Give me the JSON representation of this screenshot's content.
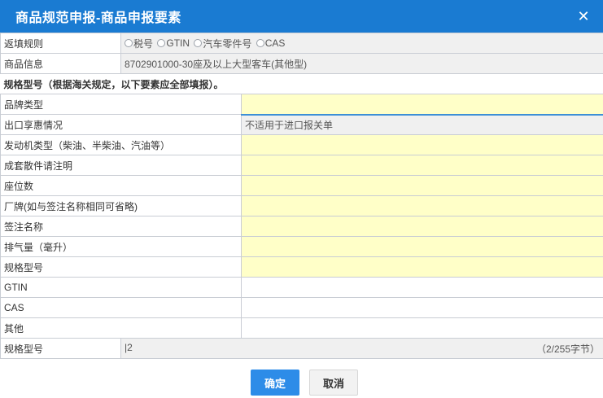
{
  "dialog": {
    "title": "商品规范申报-商品申报要素"
  },
  "rows": {
    "fill_rule": {
      "label": "返填规则",
      "options": [
        "税号",
        "GTIN",
        "汽车零件号",
        "CAS"
      ]
    },
    "goods_info": {
      "label": "商品信息",
      "value": "8702901000-30座及以上大型客车(其他型)"
    },
    "spec_header": "规格型号（根据海关规定，以下要素应全部填报）。",
    "fields": [
      {
        "label": "品牌类型",
        "value": ""
      },
      {
        "label": "出口享惠情况",
        "value": "不适用于进口报关单"
      },
      {
        "label": "发动机类型（柴油、半柴油、汽油等）",
        "value": ""
      },
      {
        "label": "成套散件请注明",
        "value": ""
      },
      {
        "label": "座位数",
        "value": ""
      },
      {
        "label": "厂牌(如与签注名称相同可省略)",
        "value": ""
      },
      {
        "label": "签注名称",
        "value": ""
      },
      {
        "label": "排气量（毫升）",
        "value": ""
      },
      {
        "label": "规格型号",
        "value": ""
      },
      {
        "label": "GTIN",
        "value": ""
      },
      {
        "label": "CAS",
        "value": ""
      },
      {
        "label": "其他",
        "value": ""
      }
    ],
    "model_summary": {
      "label": "规格型号",
      "value": "|2",
      "hint": "（2/255字节）"
    }
  },
  "footer": {
    "ok_label": "确定",
    "cancel_label": "取消"
  }
}
